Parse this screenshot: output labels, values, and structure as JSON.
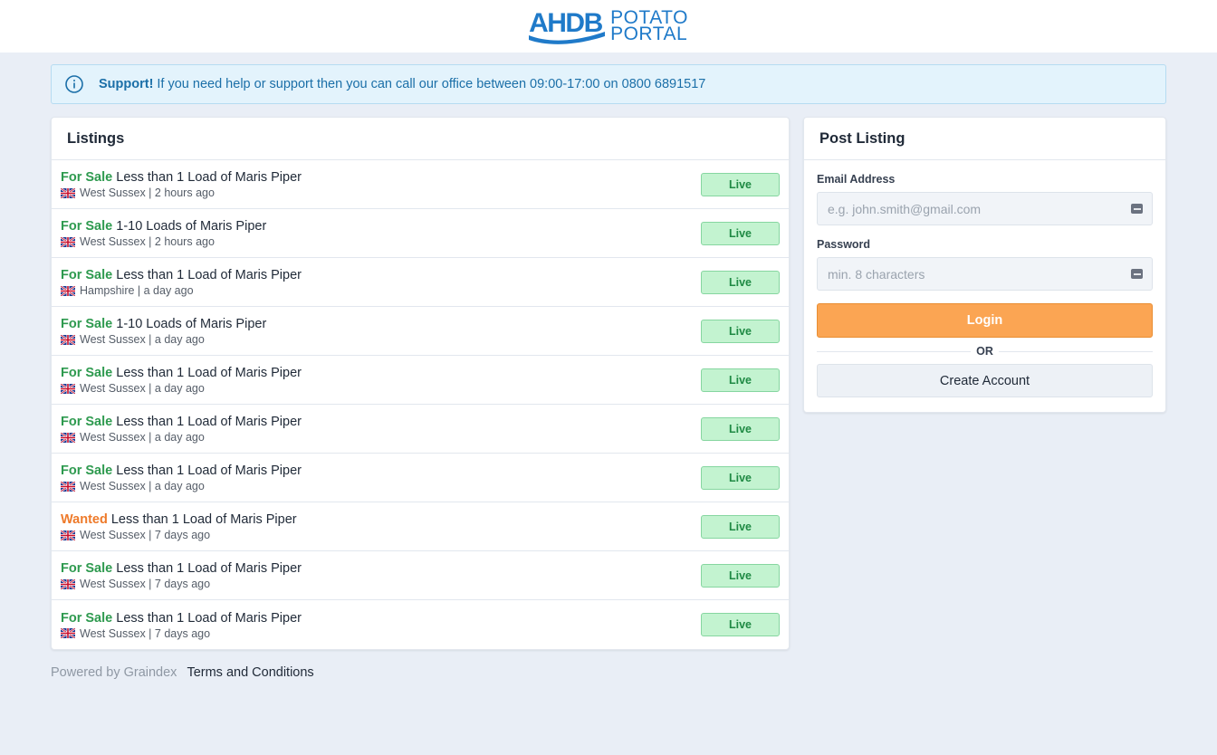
{
  "brand": {
    "mark": "AHDB",
    "line1": "POTATO",
    "line2": "PORTAL",
    "color": "#1f7ac9"
  },
  "alert": {
    "icon": "info-icon",
    "title": "Support!",
    "text": "If you need help or support then you can call our office between 09:00-17:00 on 0800 6891517"
  },
  "listings": {
    "heading": "Listings",
    "items": [
      {
        "type": "For Sale",
        "kind": "sale",
        "title": "Less than 1 Load of Maris Piper",
        "location": "West Sussex | 2 hours ago",
        "status": "Live"
      },
      {
        "type": "For Sale",
        "kind": "sale",
        "title": "1-10 Loads of Maris Piper",
        "location": "West Sussex | 2 hours ago",
        "status": "Live"
      },
      {
        "type": "For Sale",
        "kind": "sale",
        "title": "Less than 1 Load of Maris Piper",
        "location": "Hampshire | a day ago",
        "status": "Live"
      },
      {
        "type": "For Sale",
        "kind": "sale",
        "title": "1-10 Loads of Maris Piper",
        "location": "West Sussex | a day ago",
        "status": "Live"
      },
      {
        "type": "For Sale",
        "kind": "sale",
        "title": "Less than 1 Load of Maris Piper",
        "location": "West Sussex | a day ago",
        "status": "Live"
      },
      {
        "type": "For Sale",
        "kind": "sale",
        "title": "Less than 1 Load of Maris Piper",
        "location": "West Sussex | a day ago",
        "status": "Live"
      },
      {
        "type": "For Sale",
        "kind": "sale",
        "title": "Less than 1 Load of Maris Piper",
        "location": "West Sussex | a day ago",
        "status": "Live"
      },
      {
        "type": "Wanted",
        "kind": "wanted",
        "title": "Less than 1 Load of Maris Piper",
        "location": "West Sussex | 7 days ago",
        "status": "Live"
      },
      {
        "type": "For Sale",
        "kind": "sale",
        "title": "Less than 1 Load of Maris Piper",
        "location": "West Sussex | 7 days ago",
        "status": "Live"
      },
      {
        "type": "For Sale",
        "kind": "sale",
        "title": "Less than 1 Load of Maris Piper",
        "location": "West Sussex | 7 days ago",
        "status": "Live"
      }
    ]
  },
  "post": {
    "heading": "Post Listing",
    "email_label": "Email Address",
    "email_placeholder": "e.g. john.smith@gmail.com",
    "email_value": "",
    "password_label": "Password",
    "password_placeholder": "min. 8 characters",
    "password_value": "",
    "login_label": "Login",
    "or_label": "OR",
    "create_label": "Create Account"
  },
  "footer": {
    "powered": "Powered by Graindex",
    "terms": "Terms and Conditions"
  },
  "colors": {
    "background": "#e9eef6",
    "sale": "#2e9a4f",
    "wanted": "#ee7a2a",
    "live_badge": "#c3f3d0",
    "login_button": "#fba553",
    "alert_bg": "#e3f3fc"
  }
}
